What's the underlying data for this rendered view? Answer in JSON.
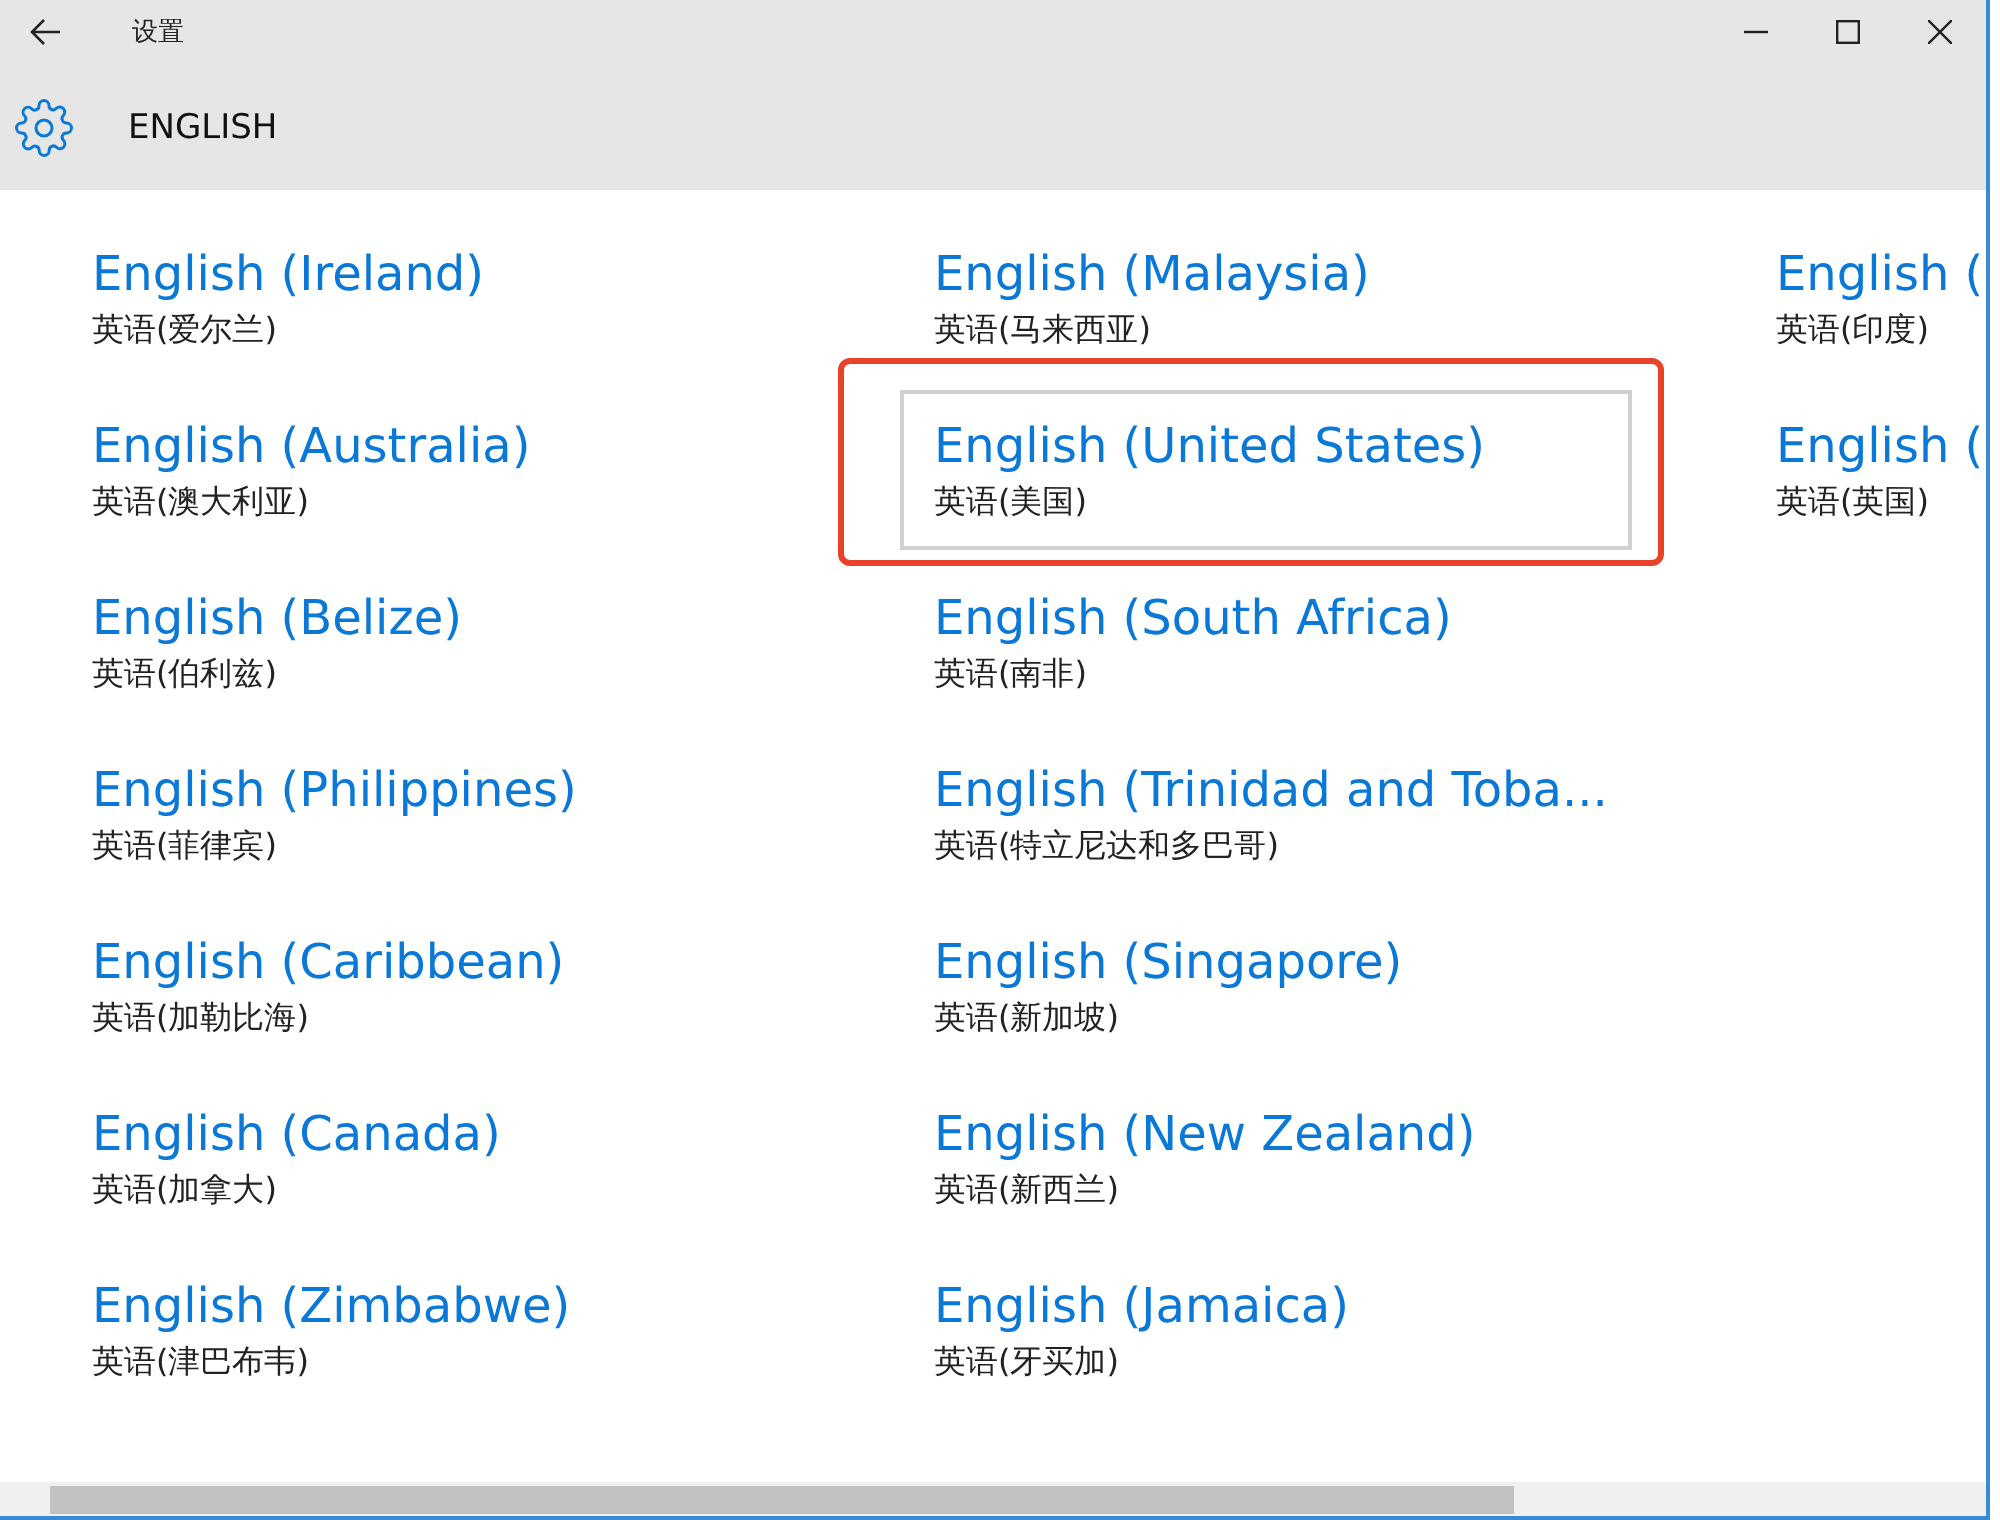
{
  "window": {
    "title": "设置"
  },
  "header": {
    "title": "ENGLISH"
  },
  "columns": [
    [
      {
        "name": "English (Ireland)",
        "native": "英语(爱尔兰)",
        "selected": false,
        "annotated": false
      },
      {
        "name": "English (Australia)",
        "native": "英语(澳大利亚)",
        "selected": false,
        "annotated": false
      },
      {
        "name": "English (Belize)",
        "native": "英语(伯利兹)",
        "selected": false,
        "annotated": false
      },
      {
        "name": "English (Philippines)",
        "native": "英语(菲律宾)",
        "selected": false,
        "annotated": false
      },
      {
        "name": "English (Caribbean)",
        "native": "英语(加勒比海)",
        "selected": false,
        "annotated": false
      },
      {
        "name": "English (Canada)",
        "native": "英语(加拿大)",
        "selected": false,
        "annotated": false
      },
      {
        "name": "English (Zimbabwe)",
        "native": "英语(津巴布韦)",
        "selected": false,
        "annotated": false
      }
    ],
    [
      {
        "name": "English (Malaysia)",
        "native": "英语(马来西亚)",
        "selected": false,
        "annotated": false
      },
      {
        "name": "English (United States)",
        "native": "英语(美国)",
        "selected": true,
        "annotated": true
      },
      {
        "name": "English (South Africa)",
        "native": "英语(南非)",
        "selected": false,
        "annotated": false
      },
      {
        "name": "English (Trinidad and Toba...",
        "native": "英语(特立尼达和多巴哥)",
        "selected": false,
        "annotated": false
      },
      {
        "name": "English (Singapore)",
        "native": "英语(新加坡)",
        "selected": false,
        "annotated": false
      },
      {
        "name": "English (New Zealand)",
        "native": "英语(新西兰)",
        "selected": false,
        "annotated": false
      },
      {
        "name": "English (Jamaica)",
        "native": "英语(牙买加)",
        "selected": false,
        "annotated": false
      }
    ],
    [
      {
        "name": "English (",
        "native": "英语(印度)",
        "selected": false,
        "annotated": false
      },
      {
        "name": "English (",
        "native": "英语(英国)",
        "selected": false,
        "annotated": false
      }
    ]
  ]
}
